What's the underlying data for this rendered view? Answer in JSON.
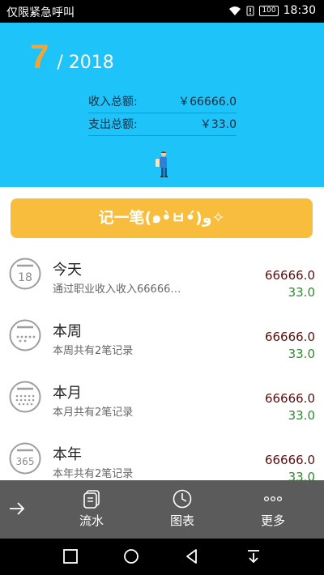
{
  "status_bar": {
    "carrier": "仅限紧急呼叫",
    "battery": "100",
    "time": "18:30"
  },
  "header": {
    "month": "7",
    "year": "/ 2018"
  },
  "summary": {
    "income_label": "收入总额:",
    "income_value": "￥66666.0",
    "expense_label": "支出总额:",
    "expense_value": "￥33.0"
  },
  "record_button": "记一笔(๑•̀ㅂ•́)و✧",
  "items": [
    {
      "title": "今天",
      "subtitle": "通过职业收入收入66666…",
      "income": "66666.0",
      "expense": "33.0",
      "icon": "calendar-day-icon",
      "icon_text": "18"
    },
    {
      "title": "本周",
      "subtitle": "本周共有2笔记录",
      "income": "66666.0",
      "expense": "33.0",
      "icon": "calendar-week-icon"
    },
    {
      "title": "本月",
      "subtitle": "本月共有2笔记录",
      "income": "66666.0",
      "expense": "33.0",
      "icon": "calendar-month-icon"
    },
    {
      "title": "本年",
      "subtitle": "本年共有2笔记录",
      "income": "66666.0",
      "expense": "33.0",
      "icon": "calendar-year-icon",
      "icon_text": "365"
    }
  ],
  "tabs": [
    {
      "label": "流水",
      "icon": "list-icon"
    },
    {
      "label": "图表",
      "icon": "clock-chart-icon"
    },
    {
      "label": "更多",
      "icon": "more-dots-icon"
    }
  ],
  "colors": {
    "header_bg": "#1ec3f9",
    "accent": "#f8bd3c",
    "month": "#f4a531",
    "income": "#5a0d0d",
    "expense": "#2c8c2c",
    "tab_bar": "#5b5b5b"
  }
}
